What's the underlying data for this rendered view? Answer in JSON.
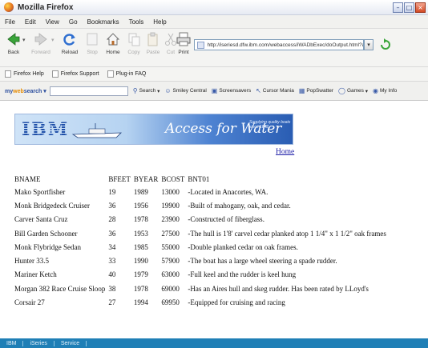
{
  "window": {
    "title": "Mozilla Firefox"
  },
  "menu": [
    "File",
    "Edit",
    "View",
    "Go",
    "Bookmarks",
    "Tools",
    "Help"
  ],
  "nav": {
    "back": "Back",
    "forward": "Forward",
    "reload": "Reload",
    "stop": "Stop",
    "home": "Home",
    "copy": "Copy",
    "paste": "Paste",
    "cut": "Cut",
    "print": "Print"
  },
  "url": "http://iseriesd.dfw.ibm.com/webaccess/iWADbExec/doOutput.html?acce",
  "bookmarks": [
    "Firefox Help",
    "Firefox Support",
    "Plug-in FAQ"
  ],
  "searchbar": {
    "brand_prefix": "my",
    "brand_web": "web",
    "brand_suffix": "search",
    "search_button": "Search",
    "items": [
      "Smiley Central",
      "Screensavers",
      "Cursor Mania",
      "PopSwatter",
      "Games",
      "My Info"
    ]
  },
  "banner": {
    "logo": "IBM",
    "title": "Access for Water",
    "tagline": "Supplying quality boats since 1842"
  },
  "home_link": "Home",
  "table": {
    "headers": [
      "BNAME",
      "BFEET",
      "BYEAR",
      "BCOST",
      "BNT01"
    ],
    "rows": [
      [
        "Mako Sportfisher",
        "19",
        "1989",
        "13000",
        "-Located in Anacortes, WA."
      ],
      [
        "Monk Bridgedeck Cruiser",
        "36",
        "1956",
        "19900",
        "-Built of mahogany, oak, and cedar."
      ],
      [
        "Carver Santa Cruz",
        "28",
        "1978",
        "23900",
        "-Constructed of fiberglass."
      ],
      [
        "Bill Garden Schooner",
        "36",
        "1953",
        "27500",
        "-The hull is 1'8' carvel cedar planked atop 1 1/4\" x 1 1/2\" oak frames"
      ],
      [
        "Monk Flybridge Sedan",
        "34",
        "1985",
        "55000",
        "-Double planked cedar on oak frames."
      ],
      [
        "Hunter 33.5",
        "33",
        "1990",
        "57900",
        "-The boat has a large wheel steering a spade rudder."
      ],
      [
        "Mariner Ketch",
        "40",
        "1979",
        "63000",
        "-Full keel and the rudder is keel hung"
      ],
      [
        "Morgan 382 Race Cruise Sloop",
        "38",
        "1978",
        "69000",
        "-Has an Aires hull and skeg rudder. Has been rated by LLoyd's"
      ],
      [
        "Corsair 27",
        "27",
        "1994",
        "69950",
        "-Equipped for cruising and racing"
      ]
    ]
  },
  "footer": [
    "IBM",
    "iSeries",
    "Service"
  ]
}
